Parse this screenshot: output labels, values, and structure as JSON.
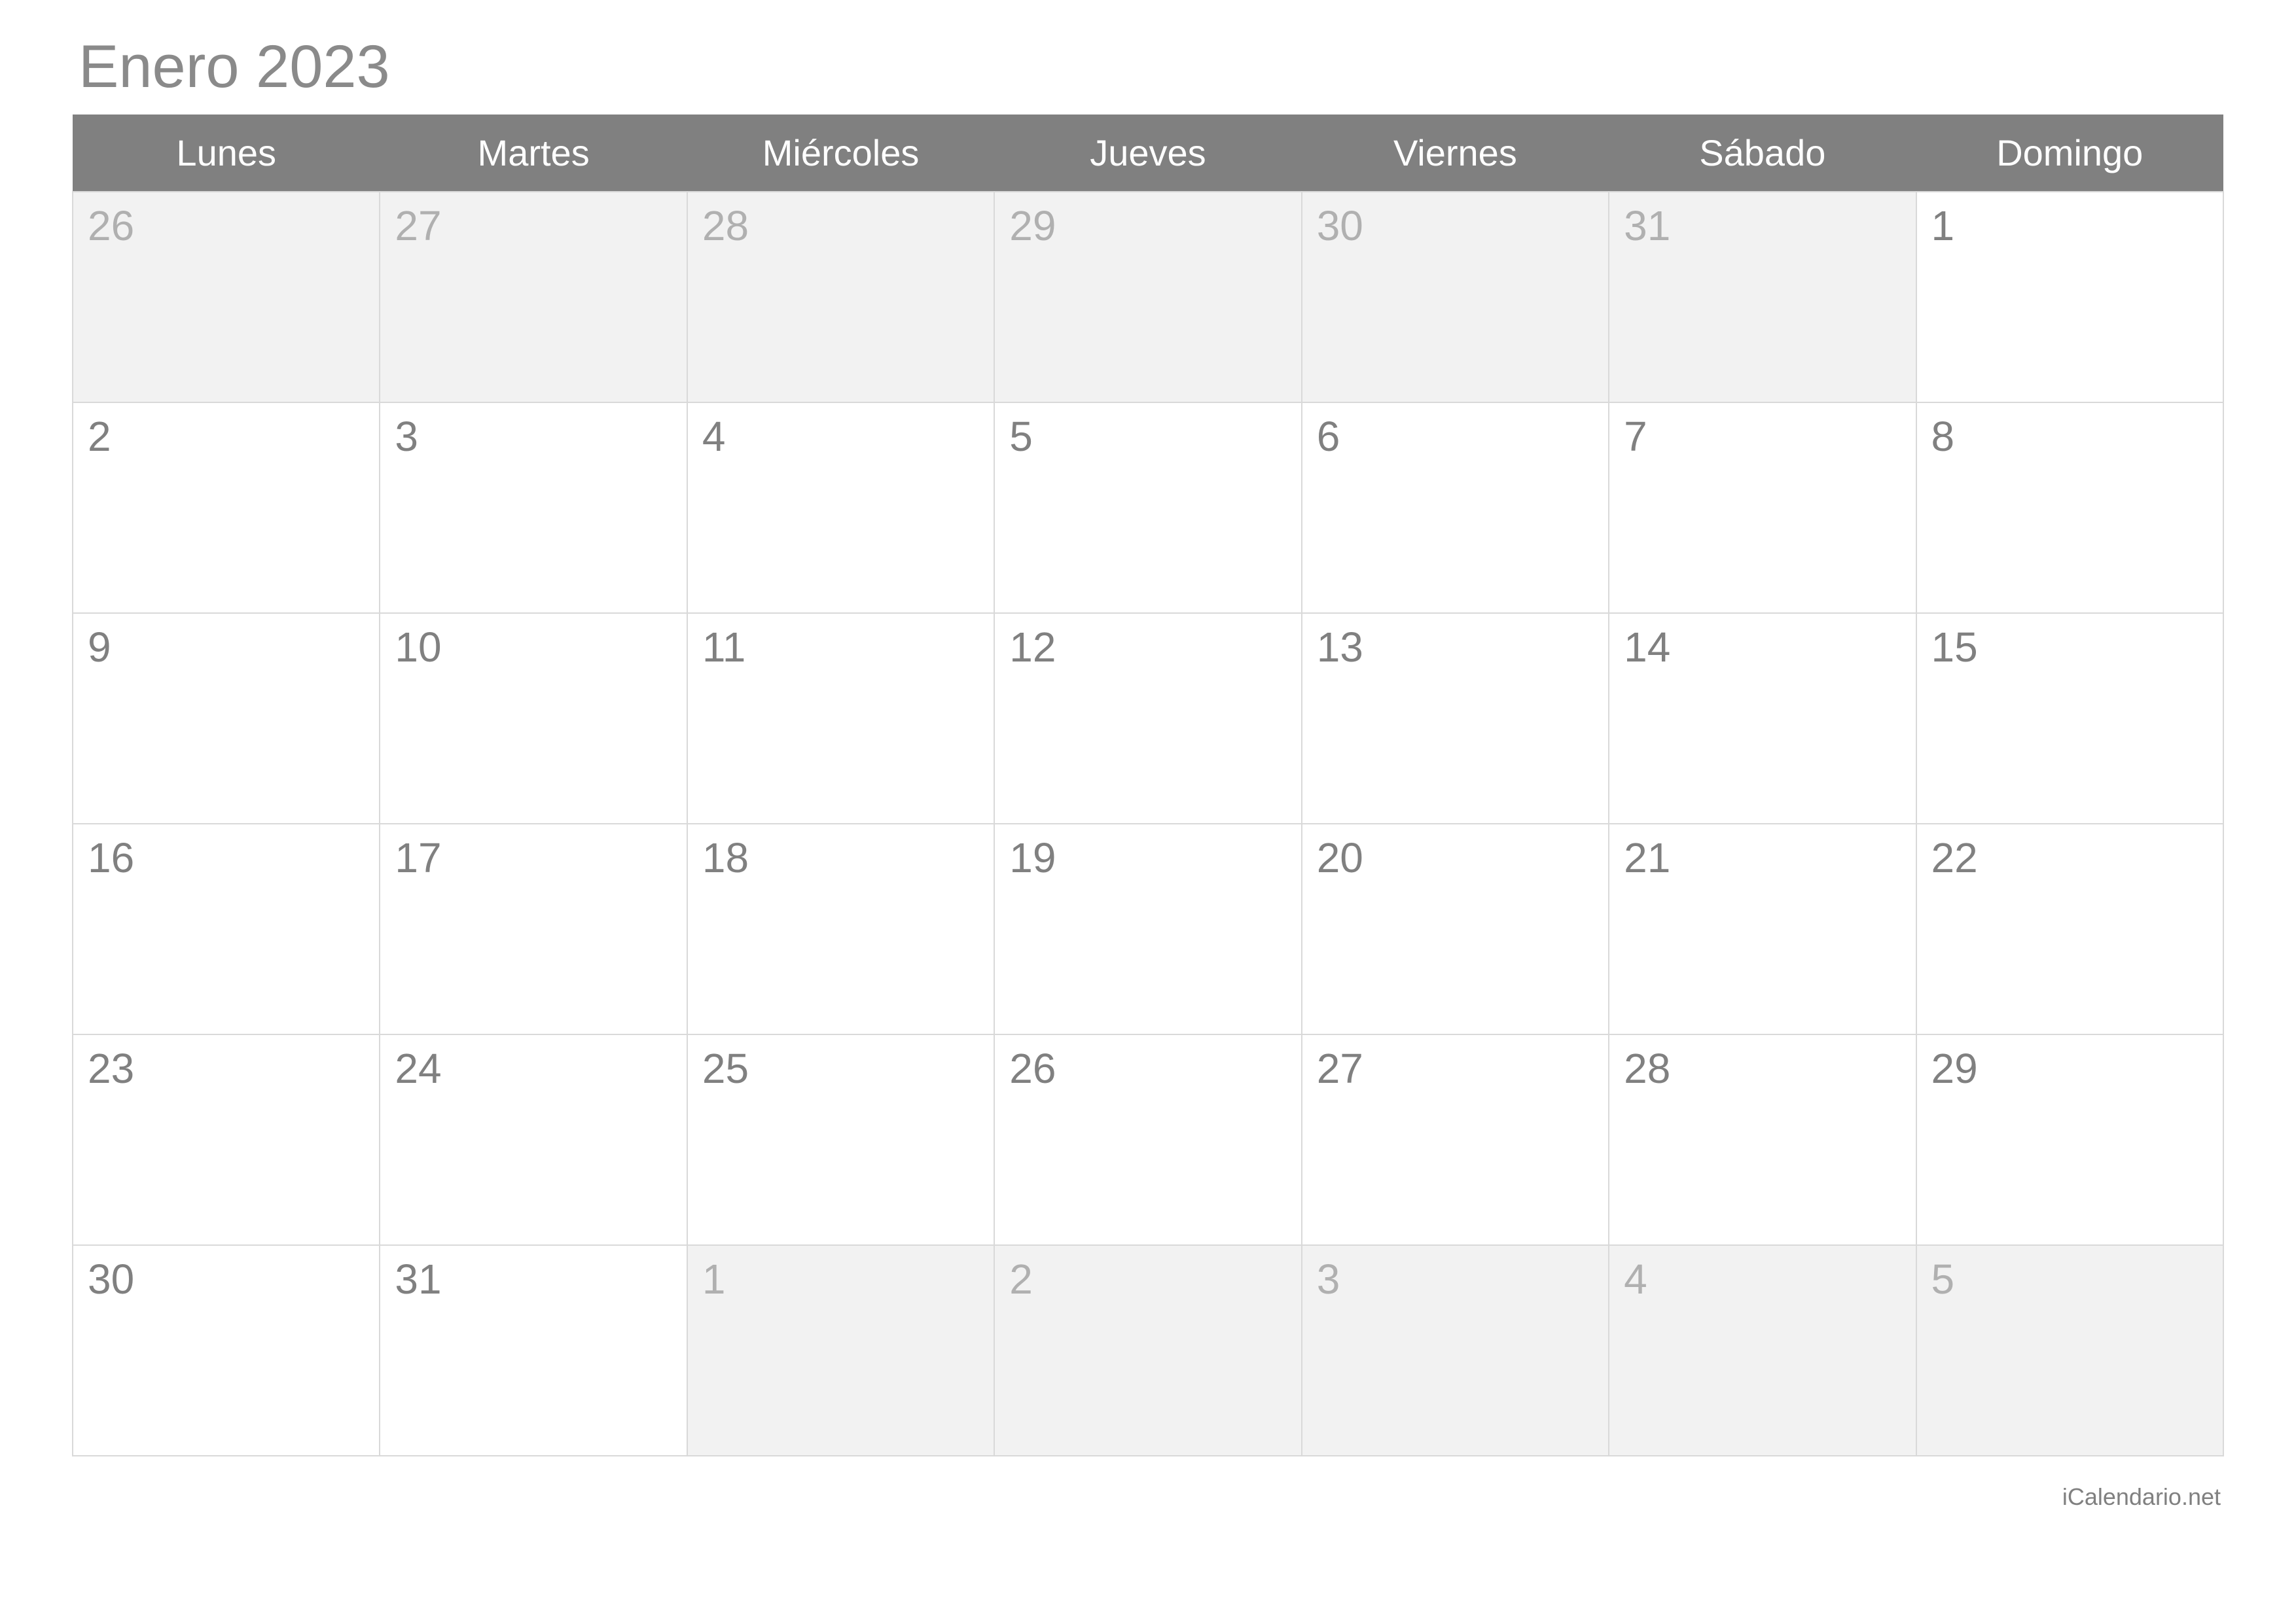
{
  "title": "Enero 2023",
  "footer": "iCalendario.net",
  "weekdays": [
    "Lunes",
    "Martes",
    "Miércoles",
    "Jueves",
    "Viernes",
    "Sábado",
    "Domingo"
  ],
  "weeks": [
    [
      {
        "day": "26",
        "other": true
      },
      {
        "day": "27",
        "other": true
      },
      {
        "day": "28",
        "other": true
      },
      {
        "day": "29",
        "other": true
      },
      {
        "day": "30",
        "other": true
      },
      {
        "day": "31",
        "other": true
      },
      {
        "day": "1",
        "other": false
      }
    ],
    [
      {
        "day": "2",
        "other": false
      },
      {
        "day": "3",
        "other": false
      },
      {
        "day": "4",
        "other": false
      },
      {
        "day": "5",
        "other": false
      },
      {
        "day": "6",
        "other": false
      },
      {
        "day": "7",
        "other": false
      },
      {
        "day": "8",
        "other": false
      }
    ],
    [
      {
        "day": "9",
        "other": false
      },
      {
        "day": "10",
        "other": false
      },
      {
        "day": "11",
        "other": false
      },
      {
        "day": "12",
        "other": false
      },
      {
        "day": "13",
        "other": false
      },
      {
        "day": "14",
        "other": false
      },
      {
        "day": "15",
        "other": false
      }
    ],
    [
      {
        "day": "16",
        "other": false
      },
      {
        "day": "17",
        "other": false
      },
      {
        "day": "18",
        "other": false
      },
      {
        "day": "19",
        "other": false
      },
      {
        "day": "20",
        "other": false
      },
      {
        "day": "21",
        "other": false
      },
      {
        "day": "22",
        "other": false
      }
    ],
    [
      {
        "day": "23",
        "other": false
      },
      {
        "day": "24",
        "other": false
      },
      {
        "day": "25",
        "other": false
      },
      {
        "day": "26",
        "other": false
      },
      {
        "day": "27",
        "other": false
      },
      {
        "day": "28",
        "other": false
      },
      {
        "day": "29",
        "other": false
      }
    ],
    [
      {
        "day": "30",
        "other": false
      },
      {
        "day": "31",
        "other": false
      },
      {
        "day": "1",
        "other": true
      },
      {
        "day": "2",
        "other": true
      },
      {
        "day": "3",
        "other": true
      },
      {
        "day": "4",
        "other": true
      },
      {
        "day": "5",
        "other": true
      }
    ]
  ]
}
